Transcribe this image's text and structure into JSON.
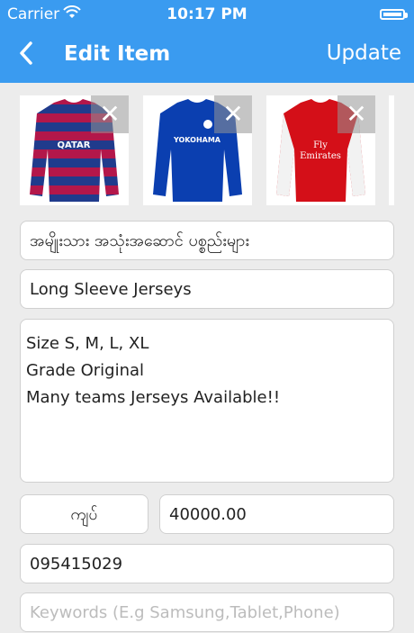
{
  "status": {
    "carrier": "Carrier",
    "time": "10:17 PM"
  },
  "nav": {
    "back_icon": "chevron-left-icon",
    "title": "Edit Item",
    "update_label": "Update"
  },
  "images": [
    {
      "name": "FC Barcelona jersey",
      "colors": [
        "#b3174a",
        "#203b8c"
      ],
      "sponsor": "QATAR"
    },
    {
      "name": "Chelsea jersey",
      "colors": [
        "#0b3fb0",
        "#0b3fb0"
      ],
      "sponsor": "YOKOHAMA"
    },
    {
      "name": "Arsenal jersey",
      "colors": [
        "#d40f18",
        "#f2f2f2"
      ],
      "sponsor": "Fly Emirates"
    }
  ],
  "form": {
    "category": "အမျိုးသား အသုံးအဆောင် ပစ္စည်းများ",
    "item_name": "Long Sleeve Jerseys",
    "description": "Size S, M, L, XL\nGrade Original\nMany teams Jerseys Available!!",
    "currency": "ကျပ်",
    "price": "40000.00",
    "phone": "095415029",
    "keywords_placeholder": "Keywords (E.g Samsung,Tablet,Phone)"
  }
}
